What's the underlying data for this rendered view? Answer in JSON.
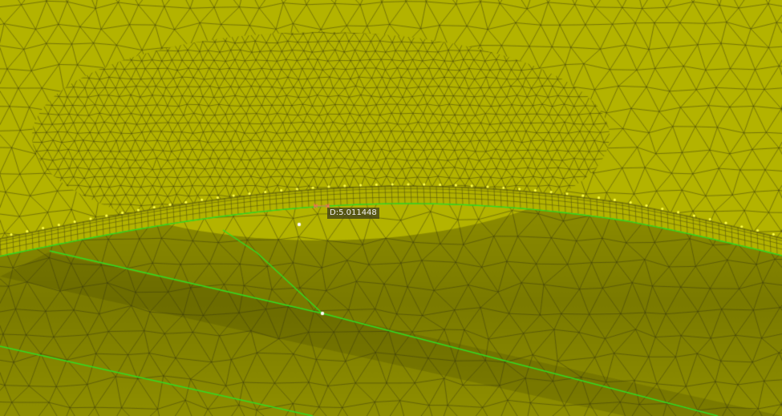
{
  "viewport": {
    "measurement": {
      "label": "D:5.011448"
    },
    "colors": {
      "surface_top": "#b3b300",
      "surface_bottom": "#8e8e00",
      "mesh_edge": "#3a3a10",
      "feature_edge": "#33dd22",
      "boundary_node": "#ffff44",
      "selected_node": "#ffffff",
      "measure_handle": "#ff6666"
    }
  }
}
